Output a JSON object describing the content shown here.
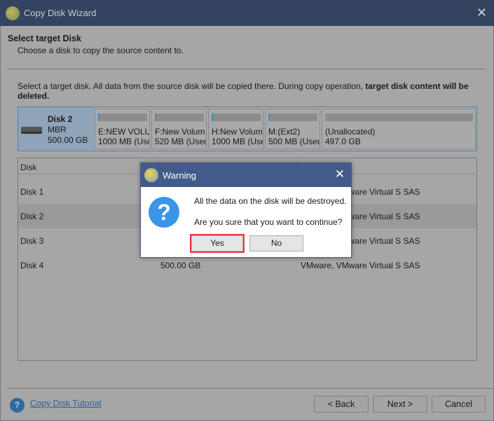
{
  "window": {
    "title": "Copy Disk Wizard",
    "close_icon": "close-icon"
  },
  "header": {
    "title": "Select target Disk",
    "subtitle": "Choose a disk to copy the source content to."
  },
  "description": {
    "normal": "Select a target disk. All data from the source disk will be copied there. During copy operation, ",
    "bold": "target disk content will be deleted."
  },
  "disk_map": {
    "name": "Disk 2",
    "type": "MBR",
    "size": "500.00 GB",
    "partitions": [
      {
        "label": "E:NEW VOLU",
        "info": "1000 MB (Used"
      },
      {
        "label": "F:New Volum",
        "info": "520 MB (Used"
      },
      {
        "label": "H:New Volum",
        "info": "1000 MB (Used"
      },
      {
        "label": "M:(Ext2)",
        "info": "500 MB (Used"
      },
      {
        "label": "(Unallocated)",
        "info": "497.0 GB"
      }
    ]
  },
  "table": {
    "headers": [
      "Disk",
      "",
      ""
    ],
    "rows": [
      {
        "disk": "Disk 1",
        "capacity": "",
        "model": "VMware, VMware Virtual S SAS"
      },
      {
        "disk": "Disk 2",
        "capacity": "",
        "model": "VMware, VMware Virtual S SAS"
      },
      {
        "disk": "Disk 3",
        "capacity": "",
        "model": "VMware, VMware Virtual S SAS"
      },
      {
        "disk": "Disk 4",
        "capacity": "500.00 GB",
        "model": "VMware, VMware Virtual S SAS"
      }
    ]
  },
  "footer": {
    "tutorial_link": "Copy Disk Tutorial",
    "back": "< Back",
    "next": "Next >",
    "cancel": "Cancel"
  },
  "dialog": {
    "title": "Warning",
    "line1": "All the data on the disk will be destroyed.",
    "line2": "Are you sure that you want to continue?",
    "yes": "Yes",
    "no": "No",
    "highlight_color": "#e8383d"
  }
}
